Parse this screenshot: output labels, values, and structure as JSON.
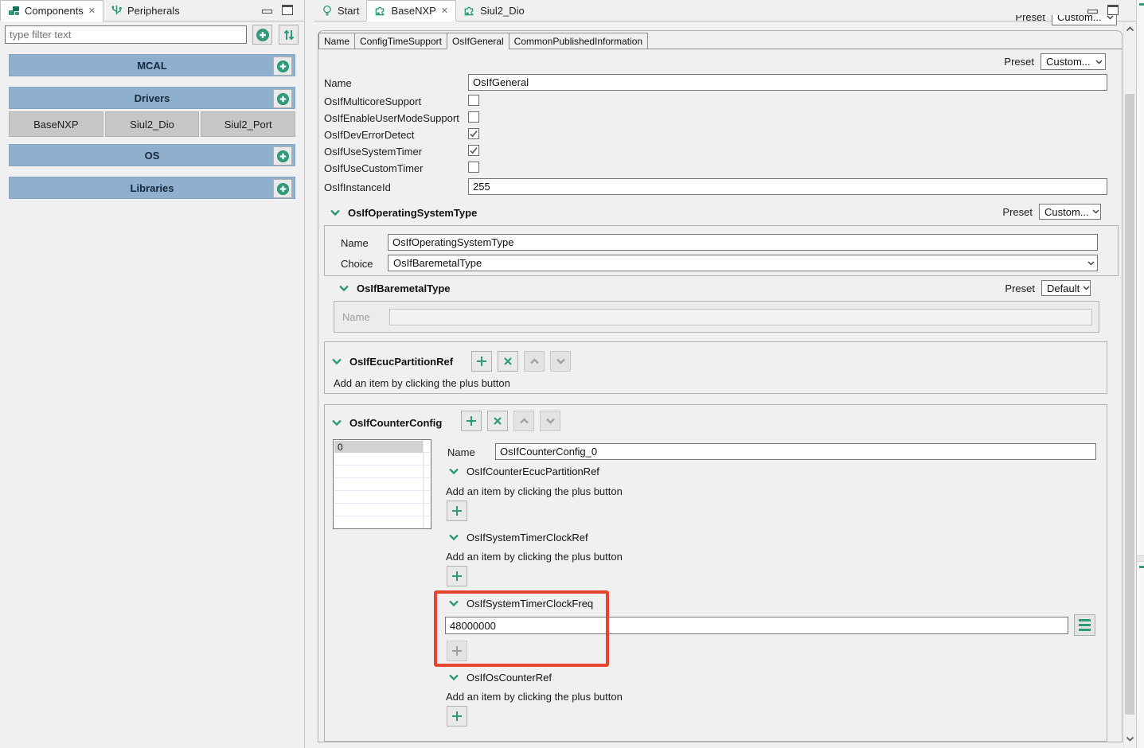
{
  "colors": {
    "accent_teal": "#2e9b78",
    "accordion_blue": "#8eafce",
    "highlight_red": "#e8432e"
  },
  "left_panel": {
    "tabs": [
      {
        "label": "Components"
      },
      {
        "label": "Peripherals"
      }
    ],
    "filter_placeholder": "type filter text",
    "sections": [
      {
        "label": "MCAL"
      },
      {
        "label": "Drivers"
      },
      {
        "label": "OS"
      },
      {
        "label": "Libraries"
      }
    ],
    "driver_items": [
      "BaseNXP",
      "Siul2_Dio",
      "Siul2_Port"
    ]
  },
  "editor_tabs": [
    {
      "label": "Start"
    },
    {
      "label": "BaseNXP"
    },
    {
      "label": "Siul2_Dio"
    }
  ],
  "subtabs": [
    "Name",
    "ConfigTimeSupport",
    "OsIfGeneral",
    "CommonPublishedInformation"
  ],
  "presets": {
    "label": "Preset",
    "top_value": "Custom...",
    "general_value": "Custom...",
    "operating_system_value": "Custom...",
    "baremetal_value": "Default"
  },
  "general": {
    "name_label": "Name",
    "name_value": "OsIfGeneral",
    "checkboxes": [
      {
        "label": "OsIfMulticoreSupport",
        "checked": false
      },
      {
        "label": "OsIfEnableUserModeSupport",
        "checked": false
      },
      {
        "label": "OsIfDevErrorDetect",
        "checked": true
      },
      {
        "label": "OsIfUseSystemTimer",
        "checked": true
      },
      {
        "label": "OsIfUseCustomTimer",
        "checked": false
      }
    ],
    "instance_id_label": "OsIfInstanceId",
    "instance_id_value": "255"
  },
  "operating_system_type": {
    "title": "OsIfOperatingSystemType",
    "name_label": "Name",
    "name_value": "OsIfOperatingSystemType",
    "choice_label": "Choice",
    "choice_value": "OsIfBaremetalType"
  },
  "baremetal_type": {
    "title": "OsIfBaremetalType",
    "name_label": "Name",
    "name_value": ""
  },
  "ecuc_partition_ref": {
    "title": "OsIfEcucPartitionRef",
    "hint": "Add an item by clicking the plus button"
  },
  "counter_config": {
    "title": "OsIfCounterConfig",
    "list_rows": [
      "0"
    ],
    "name_label": "Name",
    "name_value": "OsIfCounterConfig_0",
    "counter_ecuc_partition_ref": {
      "title": "OsIfCounterEcucPartitionRef",
      "hint": "Add an item by clicking the plus button"
    },
    "system_timer_clock_ref": {
      "title": "OsIfSystemTimerClockRef",
      "hint": "Add an item by clicking the plus button"
    },
    "system_timer_clock_freq": {
      "title": "OsIfSystemTimerClockFreq",
      "value": "48000000"
    },
    "os_counter_ref": {
      "title": "OsIfOsCounterRef",
      "hint": "Add an item by clicking the plus button"
    }
  }
}
